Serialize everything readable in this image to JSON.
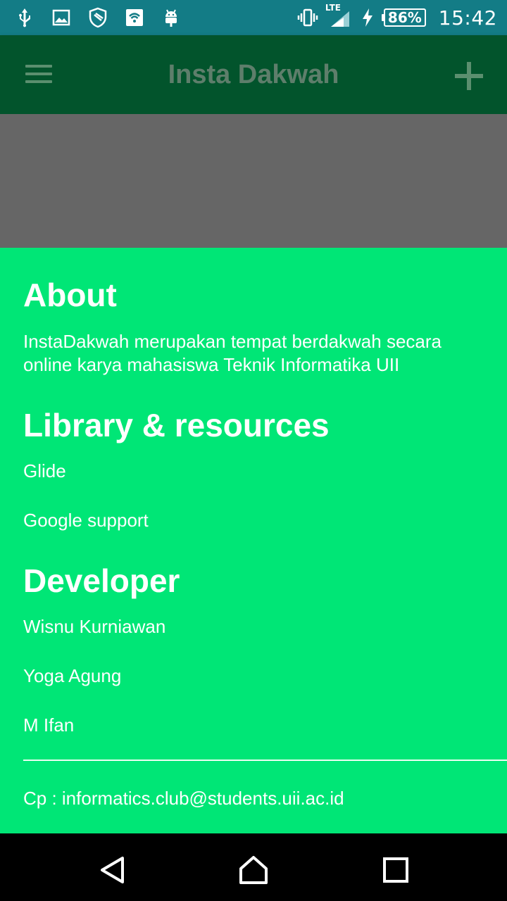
{
  "status_bar": {
    "left_icons": [
      "usb-icon",
      "image-icon",
      "shield-icon",
      "wifi-icon",
      "android-icon"
    ],
    "right_icons": [
      "vibrate-icon",
      "signal-icon",
      "charging-icon"
    ],
    "network_type": "LTE",
    "battery": "86%",
    "time": "15:42"
  },
  "app_bar": {
    "title": "Insta Dakwah",
    "menu_icon": "hamburger-menu-icon",
    "action_icon": "add-icon"
  },
  "sheet": {
    "about": {
      "heading": "About",
      "text": "InstaDakwah merupakan tempat berdakwah secara online karya mahasiswa Teknik Informatika UII"
    },
    "library": {
      "heading": "Library & resources",
      "items": [
        "Glide",
        "Google support"
      ]
    },
    "developer": {
      "heading": "Developer",
      "items": [
        "Wisnu Kurniawan",
        "Yoga Agung",
        "M Ifan"
      ]
    },
    "contact": "Cp : informatics.club@students.uii.ac.id"
  },
  "nav_bar": {
    "icons": [
      "back-icon",
      "home-icon",
      "recents-icon"
    ]
  },
  "colors": {
    "status_bar": "#137c86",
    "app_bar": "#02542c",
    "sheet_background": "#00e676",
    "backdrop": "#666666"
  }
}
